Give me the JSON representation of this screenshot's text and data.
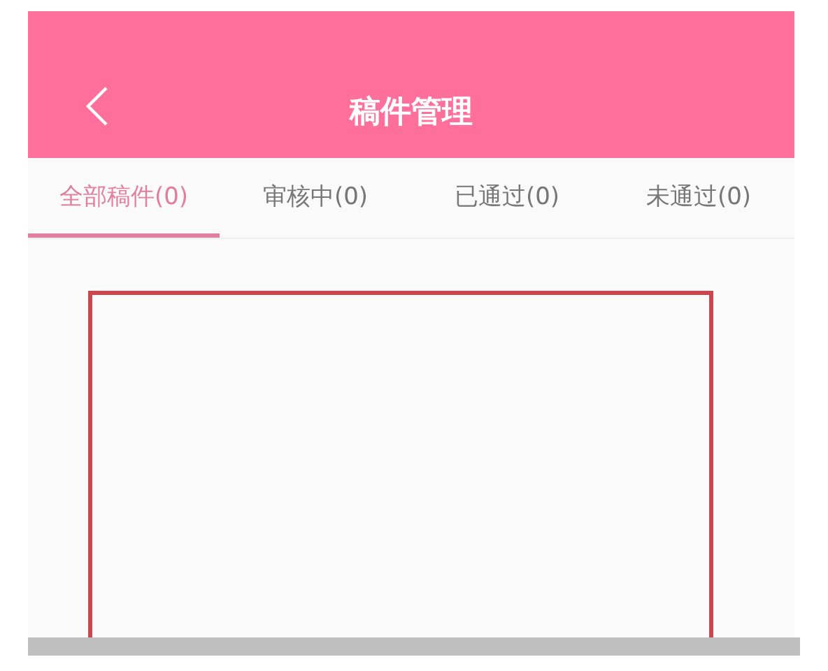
{
  "header": {
    "title": "稿件管理"
  },
  "tabs": [
    {
      "label": "全部稿件(0)",
      "selected": true
    },
    {
      "label": "审核中(0)",
      "selected": false
    },
    {
      "label": "已通过(0)",
      "selected": false
    },
    {
      "label": "未通过(0)",
      "selected": false
    }
  ]
}
